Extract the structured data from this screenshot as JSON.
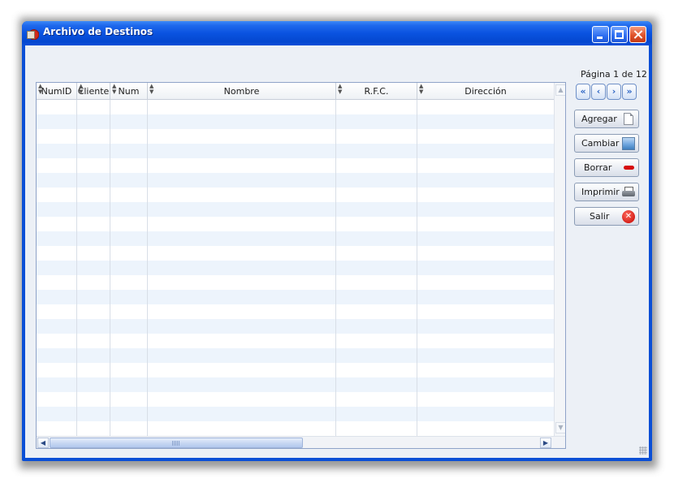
{
  "window": {
    "title": "Archivo de Destinos"
  },
  "grid": {
    "columns": [
      {
        "label": "NumID"
      },
      {
        "label": "Cliente"
      },
      {
        "label": "Num"
      },
      {
        "label": "Nombre"
      },
      {
        "label": "R.F.C."
      },
      {
        "label": "Dirección"
      }
    ],
    "rows": []
  },
  "pagination": {
    "label": "Página 1 de 12",
    "current": 1,
    "total": 12
  },
  "actions": {
    "agregar": "Agregar",
    "cambiar": "Cambiar",
    "borrar": "Borrar",
    "imprimir": "Imprimir",
    "salir": "Salir"
  },
  "icons": {
    "first": "double-chevron-left-icon",
    "prev": "chevron-left-icon",
    "next": "chevron-right-icon",
    "last": "double-chevron-right-icon"
  }
}
